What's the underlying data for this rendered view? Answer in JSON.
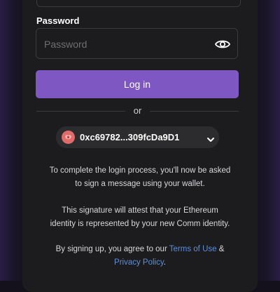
{
  "form": {
    "password_label": "Password",
    "password_placeholder": "Password",
    "login_button": "Log in",
    "divider_text": "or"
  },
  "wallet": {
    "address": "0xc69782...309fcDa9D1"
  },
  "info": {
    "login_process_line1": "To complete the login process, you'll now be asked",
    "login_process_line2": "to sign a message using your wallet.",
    "signature_line1": "This signature will attest that your Ethereum",
    "signature_line2": "identity is represented by your new Comm identity.",
    "terms_prefix": "By signing up, you agree to our ",
    "terms_link": "Terms of Use",
    "terms_and": " &",
    "privacy_link": "Privacy Policy",
    "terms_suffix": "."
  },
  "icons": {
    "show_password": "eye-icon",
    "wallet_avatar": "wallet-avatar-icon",
    "expand": "chevron-down-icon"
  },
  "colors": {
    "accent": "#7e57c2",
    "link": "#5b8fd9",
    "modal_bg": "#1c1c1e",
    "avatar": "#e06b6b"
  }
}
